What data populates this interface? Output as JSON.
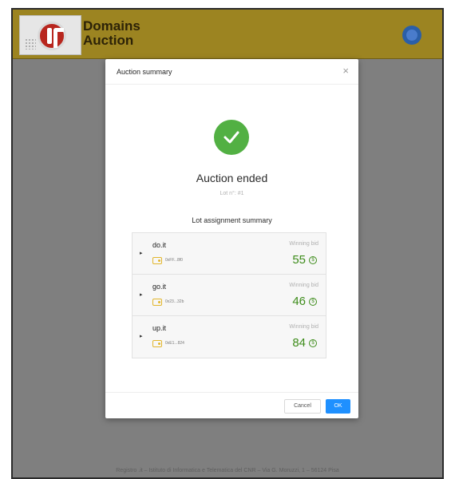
{
  "app": {
    "brand_line1": "Domains",
    "brand_line2": "Auction",
    "footer": "Registro .it – Istituto di Informatica e Telematica del CNR – Via G. Moruzzi, 1 – 56124 Pisa"
  },
  "modal": {
    "title": "Auction summary",
    "close_symbol": "×",
    "status_title": "Auction ended",
    "lot_number": "Lot n°: #1",
    "section_title": "Lot assignment summary",
    "lots": [
      {
        "domain": "do.it",
        "address": "0xFF...8f0",
        "bid_label": "Winning bid",
        "bid": "55"
      },
      {
        "domain": "go.it",
        "address": "0x23...32b",
        "bid_label": "Winning bid",
        "bid": "46"
      },
      {
        "domain": "up.it",
        "address": "0xE1...824",
        "bid_label": "Winning bid",
        "bid": "84"
      }
    ],
    "cancel_label": "Cancel",
    "ok_label": "OK"
  },
  "icons": {
    "success": "check-circle-icon",
    "wallet": "wallet-icon",
    "coin": "coin-icon",
    "expand": "caret-right-icon"
  },
  "colors": {
    "header": "#9c8421",
    "success": "#52b043",
    "bid": "#3d8c1a",
    "primary": "#1f90ff"
  }
}
